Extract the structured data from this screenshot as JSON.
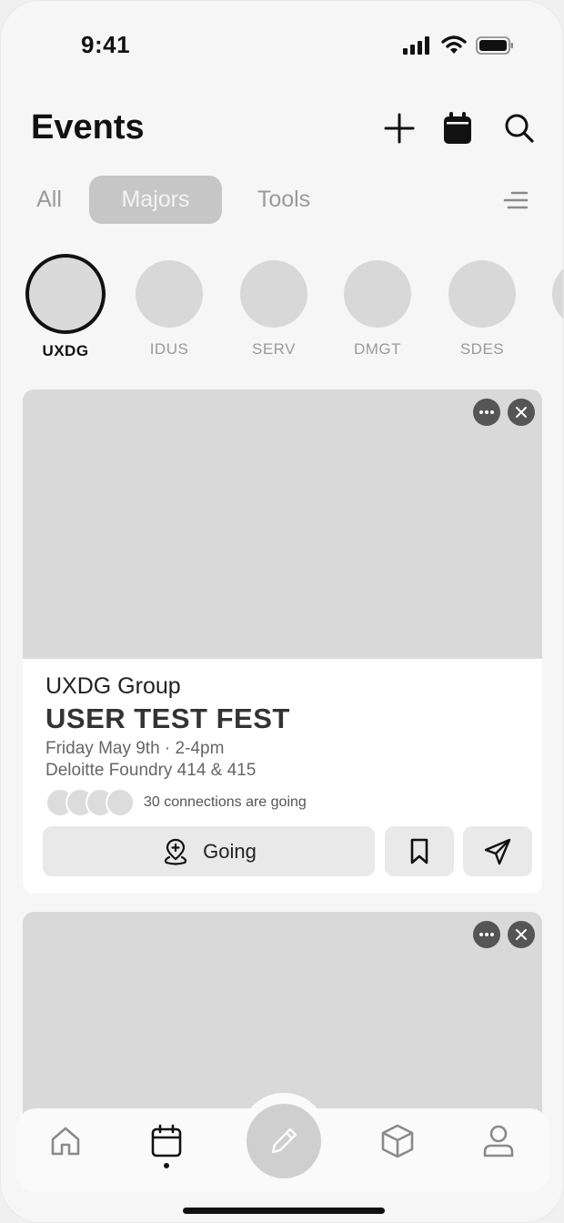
{
  "status_bar": {
    "time": "9:41",
    "icons": [
      "signal-icon",
      "wifi-icon",
      "battery-icon"
    ]
  },
  "header": {
    "title": "Events",
    "actions": [
      "add-icon",
      "calendar-icon",
      "search-icon"
    ]
  },
  "tabs": [
    {
      "label": "All",
      "active": false
    },
    {
      "label": "Majors",
      "active": true
    },
    {
      "label": "Tools",
      "active": false
    }
  ],
  "majors": [
    {
      "label": "UXDG",
      "selected": true
    },
    {
      "label": "IDUS",
      "selected": false
    },
    {
      "label": "SERV",
      "selected": false
    },
    {
      "label": "DMGT",
      "selected": false
    },
    {
      "label": "SDES",
      "selected": false
    }
  ],
  "event_card": {
    "group": "UXDG Group",
    "title": "USER TEST FEST",
    "datetime": "Friday May 9th · 2-4pm",
    "location": "Deloitte Foundry 414 & 415",
    "attendees_text": "30 connections are going",
    "going_label": "Going"
  },
  "bottom_nav": {
    "items": [
      "home-icon",
      "calendar-icon",
      "pencil-icon",
      "cube-icon",
      "profile-icon"
    ],
    "active": "calendar-icon"
  },
  "colors": {
    "tab_active_bg": "#c6c6c6",
    "placeholder": "#d9d9d9",
    "button_bg": "#e9e9e9",
    "overlay_button": "#555555"
  }
}
